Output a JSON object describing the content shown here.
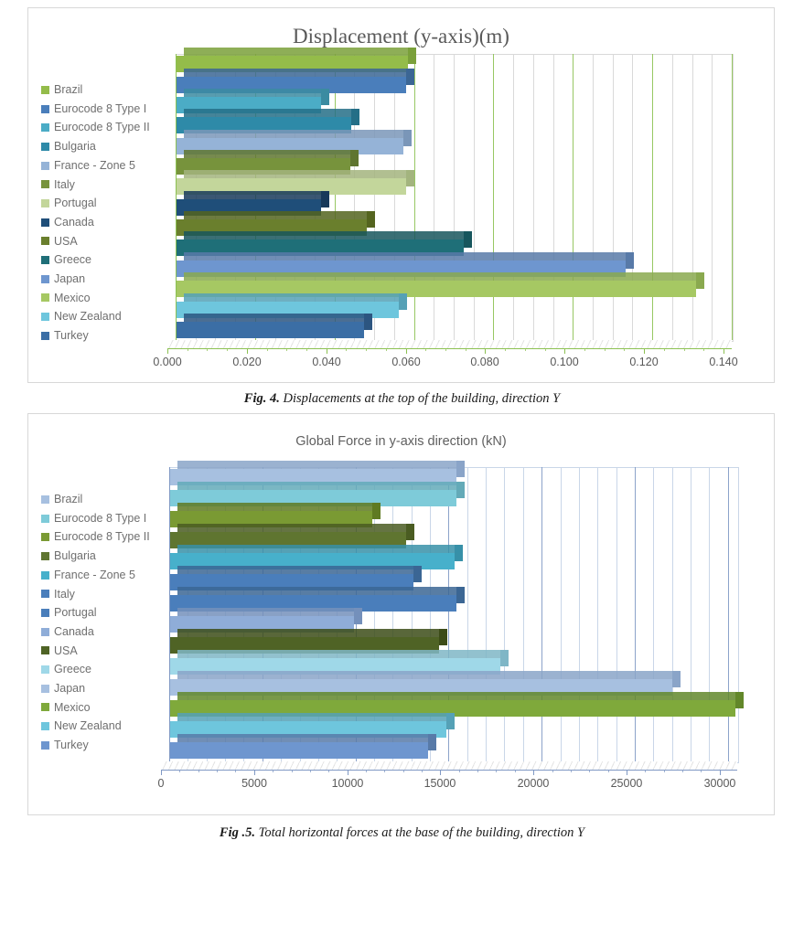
{
  "page": {
    "figures": [
      {
        "id": "fig4",
        "caption_bold": "Fig. 4.",
        "caption_rest": " Displacements at the top of the building, direction Y"
      },
      {
        "id": "fig5",
        "caption_bold": "Fig .5.",
        "caption_rest": " Total horizontal forces at the base of the building, direction Y"
      }
    ]
  },
  "chart_data": [
    {
      "type": "bar",
      "orientation": "horizontal",
      "title": "Displacement (y-axis)(m)",
      "xlabel": "",
      "ylabel": "",
      "xlim": [
        0.0,
        0.14
      ],
      "xticks": [
        "0.000",
        "0.020",
        "0.040",
        "0.060",
        "0.080",
        "0.100",
        "0.120",
        "0.140"
      ],
      "xtick_values": [
        0.0,
        0.02,
        0.04,
        0.06,
        0.08,
        0.1,
        0.12,
        0.14
      ],
      "xtick_step": 0.02,
      "minor_per_major": 3,
      "grid": true,
      "legend_position": "left",
      "axis_color": "#8cc152",
      "grid_color": "#d9d9d9",
      "categories": [
        "Brazil",
        "Eurocode 8 Type I",
        "Eurocode 8 Type II",
        "Bulgaria",
        "France - Zone 5",
        "Italy",
        "Portugal",
        "Canada",
        "USA",
        "Greece",
        "Japan",
        "Mexico",
        "New Zealand",
        "Turkey"
      ],
      "values": [
        0.0585,
        0.058,
        0.0365,
        0.0443,
        0.0573,
        0.044,
        0.058,
        0.0365,
        0.0481,
        0.0725,
        0.1132,
        0.131,
        0.0562,
        0.0475
      ],
      "colors": [
        "#94bc4a",
        "#4a7ebb",
        "#4bacc6",
        "#2e8aa8",
        "#95b3d7",
        "#77933c",
        "#c3d69b",
        "#1f4e79",
        "#6a7f2d",
        "#1f6f78",
        "#6e96cf",
        "#a6c863",
        "#6ec6dd",
        "#3b6ea5"
      ],
      "side_colors": [
        "#7aa03a",
        "#3b6694",
        "#3b8ba1",
        "#246f87",
        "#7a96b8",
        "#5f7530",
        "#a3b47e",
        "#17395a",
        "#54641f",
        "#17565d",
        "#587aa8",
        "#8aa94f",
        "#55a1b6",
        "#2c5580"
      ]
    },
    {
      "type": "bar",
      "orientation": "horizontal",
      "title": "Global Force in y-axis direction (kN)",
      "xlabel": "",
      "ylabel": "",
      "xlim": [
        0,
        30500
      ],
      "xticks": [
        "0",
        "5000",
        "10000",
        "15000",
        "20000",
        "25000",
        "30000"
      ],
      "xtick_values": [
        0,
        5000,
        10000,
        15000,
        20000,
        25000,
        30000
      ],
      "xtick_step": 5000,
      "minor_per_major": 4,
      "grid": true,
      "legend_position": "left",
      "axis_color": "#8099c4",
      "grid_color": "#c9d6e8",
      "categories": [
        "Brazil",
        "Eurocode 8 Type I",
        "Eurocode 8 Type II",
        "Bulgaria",
        "France - Zone 5",
        "Italy",
        "Portugal",
        "Canada",
        "USA",
        "Greece",
        "Japan",
        "Mexico",
        "New Zealand",
        "Turkey"
      ],
      "values": [
        15400,
        15400,
        10900,
        12700,
        15300,
        13100,
        15400,
        9900,
        14500,
        17800,
        27000,
        30400,
        14900,
        13900
      ],
      "colors": [
        "#a7c0e0",
        "#7ecbd9",
        "#7a9a33",
        "#5f7530",
        "#47b0cb",
        "#4a7ebb",
        "#4a7ebb",
        "#8fadd8",
        "#4f6325",
        "#9fd8e8",
        "#a7c0e0",
        "#7fa93b",
        "#6ec6dd",
        "#6e96cf"
      ],
      "side_colors": [
        "#8aa4c8",
        "#63aab8",
        "#5f7a22",
        "#4a5c22",
        "#3790a8",
        "#3b6694",
        "#3b6694",
        "#7490bb",
        "#3c4c18",
        "#7fb6c6",
        "#8aa4c8",
        "#62872a",
        "#55a1b6",
        "#587aa8"
      ]
    }
  ]
}
